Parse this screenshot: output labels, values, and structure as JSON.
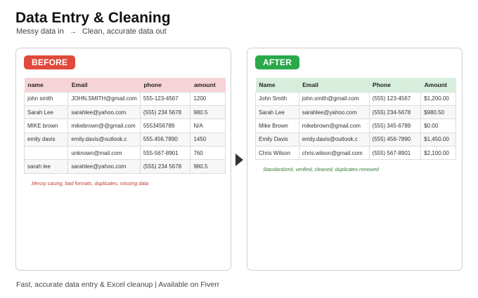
{
  "header": {
    "title": "Data Entry & Cleaning",
    "subtitle_left": "Messy data in",
    "subtitle_arrow": "→",
    "subtitle_right": "Clean, accurate data out"
  },
  "before": {
    "badge": "BEFORE",
    "columns": [
      "name",
      "Email",
      "phone",
      "amount"
    ],
    "rows": [
      [
        "john smith",
        "JOHN.SMITH@gmail.com",
        "555-123-4567",
        "1200"
      ],
      [
        "Sarah Lee",
        "sarahlee@yahoo.com",
        "(555) 234 5678",
        "980.5"
      ],
      [
        "MIKE brown",
        "mikebrown@@gmail.com",
        "5553456789",
        "N/A"
      ],
      [
        "emily davis",
        "emily.davis@outlook.c",
        "555.456.7890",
        "1450"
      ],
      [
        "",
        "unknown@mail.com",
        "555-567-8901",
        "760"
      ],
      [
        "sarah lee",
        "sarahlee@yahoo.com",
        "(555) 234 5678",
        "980.5"
      ]
    ],
    "note": "Messy casing, bad formats, duplicates, missing data"
  },
  "after": {
    "badge": "AFTER",
    "columns": [
      "Name",
      "Email",
      "Phone",
      "Amount"
    ],
    "rows": [
      [
        "John Smith",
        "john.smith@gmail.com",
        "(555) 123-4567",
        "$1,200.00"
      ],
      [
        "Sarah Lee",
        "sarahlee@yahoo.com",
        "(555) 234-5678",
        "$980.50"
      ],
      [
        "Mike Brown",
        "mikebrown@gmail.com",
        "(555) 345-6789",
        "$0.00"
      ],
      [
        "Emily Davis",
        "emily.davis@outlook.c",
        "(555) 456-7890",
        "$1,450.00"
      ],
      [
        "Chris Wilson",
        "chris.wilson@gmail.com",
        "(555) 567-8901",
        "$2,100.00"
      ]
    ],
    "note": "Standardized, verified, cleaned, duplicates removed"
  },
  "footer": {
    "text": "Fast, accurate data entry & Excel cleanup  |  Available on Fiverr"
  },
  "colors": {
    "before_badge": "#e0493b",
    "after_badge": "#2aa84a",
    "before_header": "#f6d3d6",
    "after_header": "#d8eedd",
    "before_note": "#c0392b",
    "after_note": "#2f7d32"
  }
}
